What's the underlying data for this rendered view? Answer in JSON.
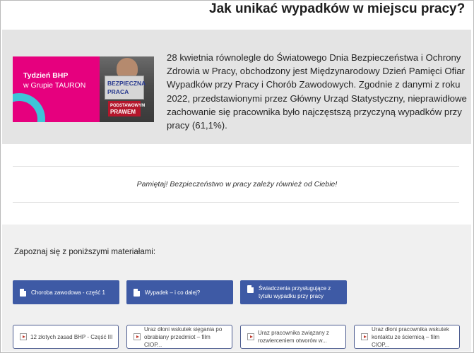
{
  "page": {
    "title": "Jak unikać wypadków w miejscu pracy?"
  },
  "intro": {
    "banner": {
      "line1": "Tydzień BHP",
      "line2": "w Grupie TAURON",
      "sign_line1": "BEZPIECZNA",
      "sign_line2": "PRACA",
      "badge_line1": "PODSTAWOWYM",
      "badge_line2": "PRAWEM"
    },
    "text": "28 kwietnia równolegle do Światowego Dnia Bezpieczeństwa i Ochrony Zdrowia w Pracy, obchodzony jest Międzynarodowy Dzień Pamięci Ofiar Wypadków przy Pracy i Chorób Zawodowych. Zgodnie z danymi z roku 2022, przedstawionymi przez Główny Urząd Statystyczny, nieprawidłowe zachowanie się pracownika było najczęstszą przyczyną wypadków przy pracy (61,1%)."
  },
  "reminder": "Pamiętaj! Bezpieczeństwo w pracy zależy również od Ciebie!",
  "materials": {
    "heading": "Zapoznaj się z poniższymi materiałami:",
    "documents": [
      {
        "label": "Choroba zawodowa - część 1"
      },
      {
        "label": "Wypadek – i co dalej?"
      },
      {
        "label": "Świadczenia przysługujące z tytułu wypadku przy pracy"
      }
    ],
    "videos": [
      {
        "label": "12 złotych zasad BHP - Część III"
      },
      {
        "label": "Uraz dłoni wskutek sięgania po obrabiany przedmiot – film CIOP..."
      },
      {
        "label": "Uraz pracownika związany z rozwierceniem otworów w..."
      },
      {
        "label": "Uraz dłoni pracownika wskutek kontaktu ze ściernicą – film CIOP..."
      }
    ]
  },
  "colors": {
    "banner_magenta": "#e6007e",
    "banner_cyan": "#3ec4d8",
    "button_blue": "#3e5aa5",
    "panel_grey": "#e4e4e4"
  }
}
